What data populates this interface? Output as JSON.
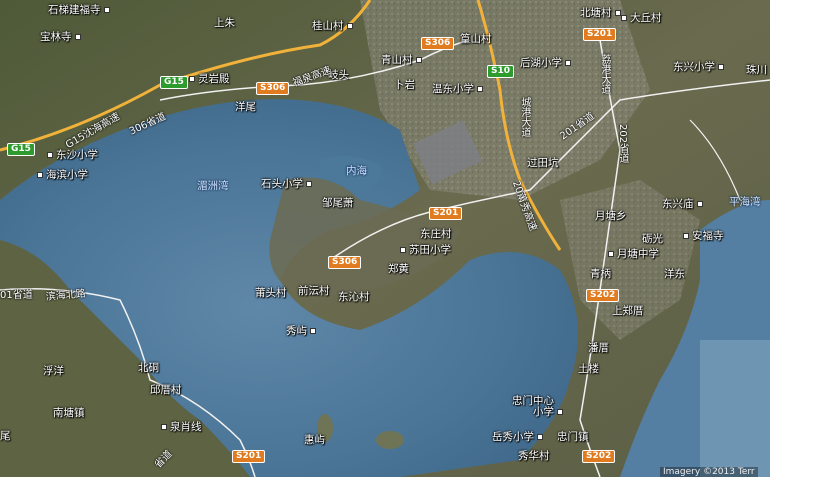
{
  "places": [
    {
      "id": "shitijianfusi",
      "text": "石梯建福寺"
    },
    {
      "id": "shangzhu",
      "text": "上朱"
    },
    {
      "id": "guishancun",
      "text": "桂山村"
    },
    {
      "id": "baolinsi",
      "text": "宝林寺"
    },
    {
      "id": "lingyandian",
      "text": "灵岩殿"
    },
    {
      "id": "qitou",
      "text": "岐头"
    },
    {
      "id": "qingshancun",
      "text": "青山村"
    },
    {
      "id": "boshancun",
      "text": "篁山村"
    },
    {
      "id": "beitangcun",
      "text": "北塘村"
    },
    {
      "id": "dakiucun",
      "text": "大丘村"
    },
    {
      "id": "buyan",
      "text": "卜岩"
    },
    {
      "id": "houhuxiaoxue",
      "text": "后湖小学"
    },
    {
      "id": "dongxingxiaoxue",
      "text": "东兴小学"
    },
    {
      "id": "zhuchuan",
      "text": "珠川"
    },
    {
      "id": "yangwei",
      "text": "洋尾"
    },
    {
      "id": "wendongxiaoxue",
      "text": "温东小学"
    },
    {
      "id": "dongshaxiaoxue",
      "text": "东沙小学"
    },
    {
      "id": "haibinxiaoxue",
      "text": "海滨小学"
    },
    {
      "id": "shitouxiaoxue",
      "text": "石头小学"
    },
    {
      "id": "guotiankeng",
      "text": "过田坑"
    },
    {
      "id": "zouweixiao",
      "text": "邹尾萧"
    },
    {
      "id": "yuetangxiang",
      "text": "月塘乡"
    },
    {
      "id": "dongxingmiao",
      "text": "东兴庙"
    },
    {
      "id": "dongzhuangcun",
      "text": "东庄村"
    },
    {
      "id": "sutianxiaoxue",
      "text": "苏田小学"
    },
    {
      "id": "yanguang",
      "text": "砺光"
    },
    {
      "id": "anfusi",
      "text": "安福寺"
    },
    {
      "id": "yuetangzhongxue",
      "text": "月塘中学"
    },
    {
      "id": "zhenghuang",
      "text": "郑黄"
    },
    {
      "id": "qingbing",
      "text": "青柄"
    },
    {
      "id": "yangdong",
      "text": "洋东"
    },
    {
      "id": "putoucun",
      "text": "莆头村"
    },
    {
      "id": "qianyuncun",
      "text": "前沄村"
    },
    {
      "id": "dongqincun",
      "text": "东沁村"
    },
    {
      "id": "shangzhengcuo",
      "text": "上郑厝"
    },
    {
      "id": "xiuyu",
      "text": "秀屿"
    },
    {
      "id": "pancuo",
      "text": "潘厝"
    },
    {
      "id": "beigong",
      "text": "北硐"
    },
    {
      "id": "fuyang",
      "text": "浮洋"
    },
    {
      "id": "qiucuocun",
      "text": "邱厝村"
    },
    {
      "id": "tulou",
      "text": "土楼"
    },
    {
      "id": "nantangzhen",
      "text": "南塘镇"
    },
    {
      "id": "quanxiaoxian",
      "text": "泉肖线"
    },
    {
      "id": "zhimenzhongxinxiaoxue1",
      "text": "忠门中心"
    },
    {
      "id": "zhimenzhongxinxiaoxue2",
      "text": "小学"
    },
    {
      "id": "weixi",
      "text": "尾"
    },
    {
      "id": "huiyu",
      "text": "惠屿"
    },
    {
      "id": "yuexiuxiaoxue",
      "text": "岳秀小学"
    },
    {
      "id": "zhongmenzhen",
      "text": "忠门镇"
    },
    {
      "id": "xiuhuacun",
      "text": "秀华村"
    }
  ],
  "water": [
    {
      "id": "neihai",
      "text": "内海"
    },
    {
      "id": "wenzhouwan",
      "text": "湄洲湾"
    },
    {
      "id": "pinghaiwan",
      "text": "平海湾"
    }
  ],
  "shields": [
    {
      "id": "s306a",
      "text": "S306",
      "kind": "prov"
    },
    {
      "id": "s306b",
      "text": "S306",
      "kind": "prov"
    },
    {
      "id": "s306c",
      "text": "S306",
      "kind": "prov"
    },
    {
      "id": "s201a",
      "text": "S201",
      "kind": "prov"
    },
    {
      "id": "s201b",
      "text": "S201",
      "kind": "prov"
    },
    {
      "id": "s202a",
      "text": "S202",
      "kind": "prov"
    },
    {
      "id": "s202b",
      "text": "S202",
      "kind": "prov"
    },
    {
      "id": "s201c",
      "text": "S201",
      "kind": "prov"
    },
    {
      "id": "g15a",
      "text": "G15",
      "kind": "exp"
    },
    {
      "id": "g15b",
      "text": "G15",
      "kind": "exp"
    },
    {
      "id": "s10",
      "text": "S10",
      "kind": "exp"
    }
  ],
  "roadnames": [
    {
      "id": "fuquangaosu",
      "text": "福泉高速"
    },
    {
      "id": "g15shenhai",
      "text": "G15沈海高速"
    },
    {
      "id": "sheng306",
      "text": "306省道"
    },
    {
      "id": "chenggangdadao",
      "text": "城港大道"
    },
    {
      "id": "sheng201",
      "text": "201省道"
    },
    {
      "id": "xiuganggang",
      "text": "荔港大道"
    },
    {
      "id": "sheng202",
      "text": "202省道"
    },
    {
      "id": "sheng201west",
      "text": "01省道"
    },
    {
      "id": "binhaibeilu",
      "text": "滨海北路"
    },
    {
      "id": "xiangyinggaosu",
      "text": "20莆秀高速"
    },
    {
      "id": "sheng201south",
      "text": "省道"
    }
  ],
  "copyright": "Imagery ©2013 Terr"
}
